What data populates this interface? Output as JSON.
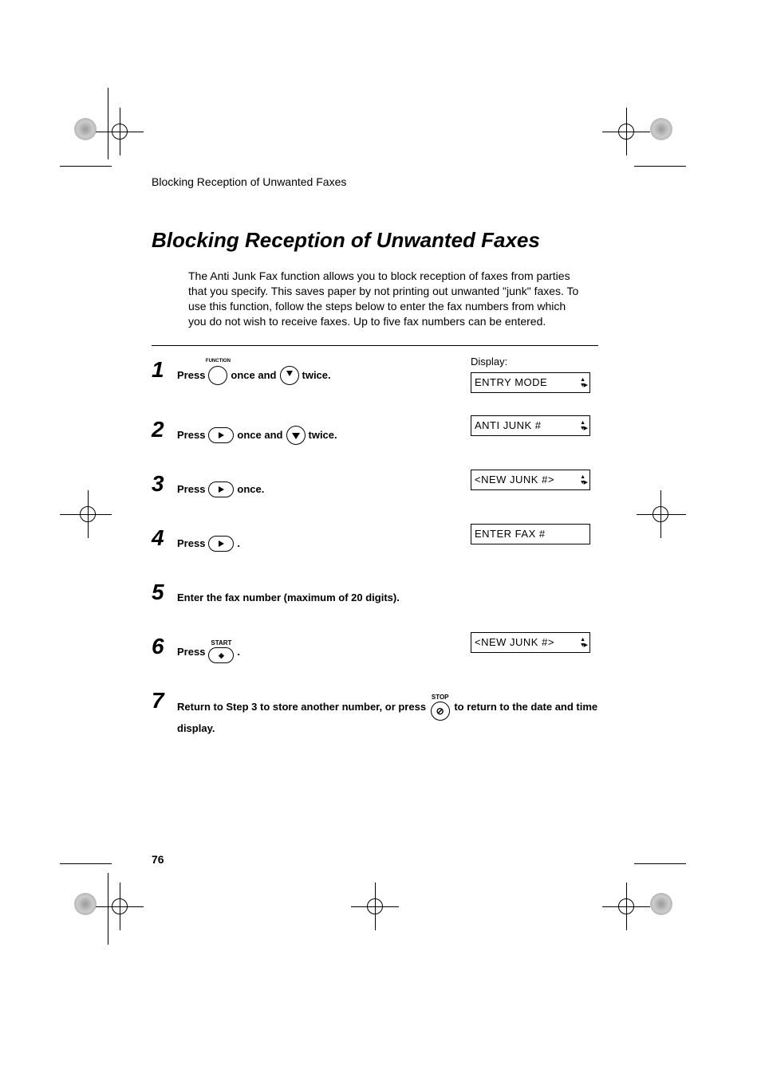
{
  "running_head": "Blocking Reception of Unwanted Faxes",
  "title": "Blocking Reception of Unwanted Faxes",
  "intro": "The Anti Junk Fax function allows you to block reception of faxes from parties that you specify. This saves paper by not printing out unwanted \"junk\" faxes. To use this function, follow the steps below to enter the fax numbers from which you do not wish to receive faxes. Up to five fax numbers can be entered.",
  "display_label": "Display:",
  "steps": {
    "s1": {
      "press": "Press",
      "func_label": "FUNCTION",
      "mid1": "once and",
      "mid2": "twice.",
      "lcd": "ENTRY MODE"
    },
    "s2": {
      "press": "Press",
      "mid1": "once and",
      "mid2": "twice.",
      "lcd": "ANTI JUNK #"
    },
    "s3": {
      "press": "Press",
      "mid1": "once.",
      "lcd": "<NEW JUNK #>"
    },
    "s4": {
      "press": "Press",
      "dot": ".",
      "lcd": "ENTER FAX #"
    },
    "s5": {
      "text": "Enter the fax number (maximum of 20 digits)."
    },
    "s6": {
      "press": "Press",
      "start_label": "START",
      "dot": ".",
      "lcd": "<NEW JUNK #>"
    },
    "s7": {
      "a": "Return to Step 3 to store another number, or press",
      "stop_label": "STOP",
      "b": "to return to the date and time display."
    }
  },
  "page_number": "76"
}
